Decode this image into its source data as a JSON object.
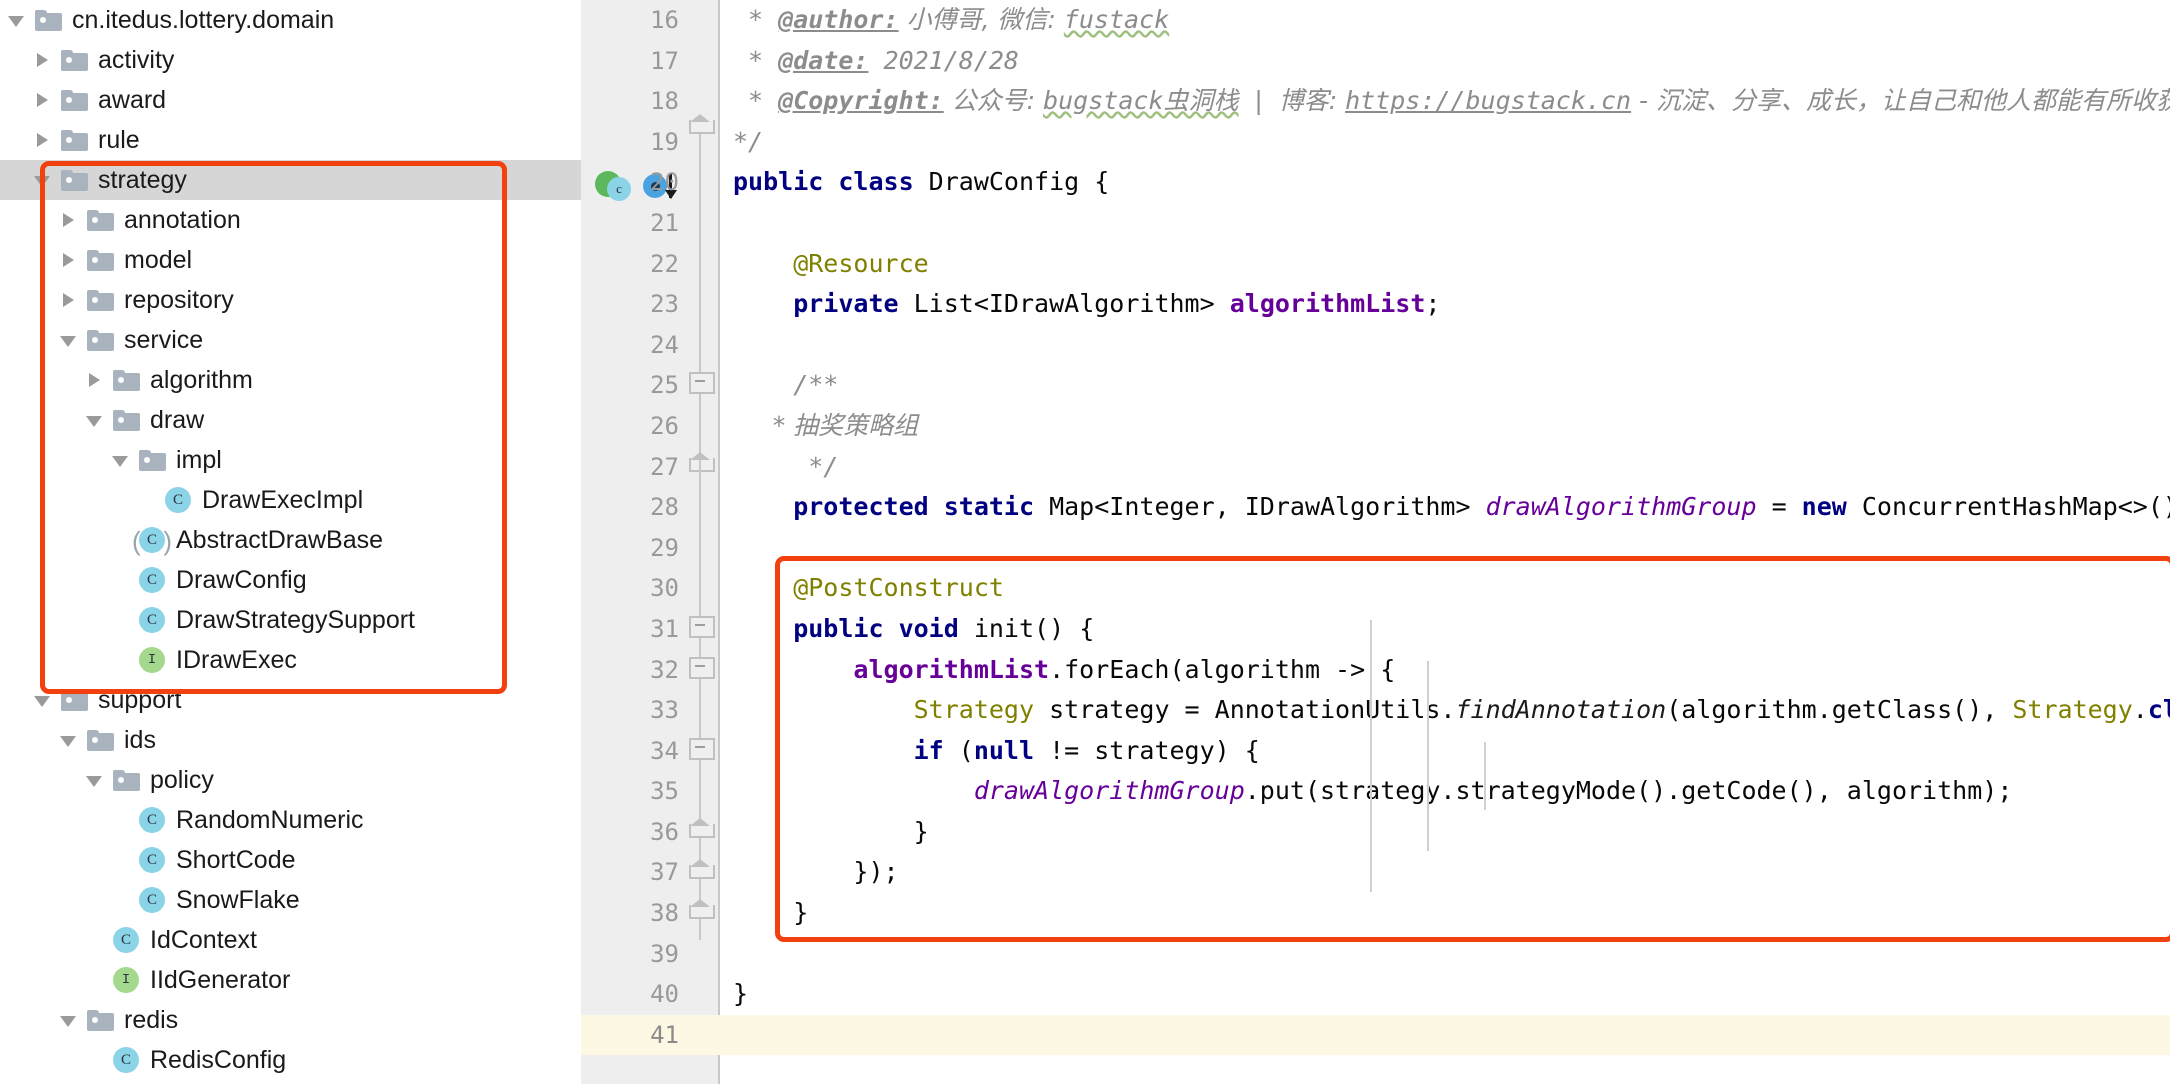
{
  "accent": {
    "highlight_box": "#f2400f",
    "selection_row": "#d6d6d6",
    "caret_line": "#fdf8e3",
    "gutter_bg": "#eeeeee"
  },
  "tree": {
    "root_label": "cn.itedus.lottery.domain",
    "items": [
      {
        "label": "cn.itedus.lottery.domain",
        "kind": "folder",
        "depth": 0,
        "state": "expanded",
        "selected": false
      },
      {
        "label": "activity",
        "kind": "folder",
        "depth": 1,
        "state": "collapsed",
        "selected": false
      },
      {
        "label": "award",
        "kind": "folder",
        "depth": 1,
        "state": "collapsed",
        "selected": false
      },
      {
        "label": "rule",
        "kind": "folder",
        "depth": 1,
        "state": "collapsed",
        "selected": false
      },
      {
        "label": "strategy",
        "kind": "folder",
        "depth": 1,
        "state": "expanded",
        "selected": true
      },
      {
        "label": "annotation",
        "kind": "folder",
        "depth": 2,
        "state": "collapsed",
        "selected": false
      },
      {
        "label": "model",
        "kind": "folder",
        "depth": 2,
        "state": "collapsed",
        "selected": false
      },
      {
        "label": "repository",
        "kind": "folder",
        "depth": 2,
        "state": "collapsed",
        "selected": false
      },
      {
        "label": "service",
        "kind": "folder",
        "depth": 2,
        "state": "expanded",
        "selected": false
      },
      {
        "label": "algorithm",
        "kind": "folder",
        "depth": 3,
        "state": "collapsed",
        "selected": false
      },
      {
        "label": "draw",
        "kind": "folder",
        "depth": 3,
        "state": "expanded",
        "selected": false
      },
      {
        "label": "impl",
        "kind": "folder",
        "depth": 4,
        "state": "expanded",
        "selected": false
      },
      {
        "label": "DrawExecImpl",
        "kind": "class",
        "depth": 5,
        "state": "leaf",
        "selected": false
      },
      {
        "label": "AbstractDrawBase",
        "kind": "abstract-class",
        "depth": 4,
        "state": "leaf",
        "selected": false
      },
      {
        "label": "DrawConfig",
        "kind": "class",
        "depth": 4,
        "state": "leaf",
        "selected": false
      },
      {
        "label": "DrawStrategySupport",
        "kind": "class",
        "depth": 4,
        "state": "leaf",
        "selected": false
      },
      {
        "label": "IDrawExec",
        "kind": "interface",
        "depth": 4,
        "state": "leaf",
        "selected": false
      },
      {
        "label": "support",
        "kind": "folder",
        "depth": 1,
        "state": "expanded",
        "selected": false
      },
      {
        "label": "ids",
        "kind": "folder",
        "depth": 2,
        "state": "expanded",
        "selected": false
      },
      {
        "label": "policy",
        "kind": "folder",
        "depth": 3,
        "state": "expanded",
        "selected": false
      },
      {
        "label": "RandomNumeric",
        "kind": "class",
        "depth": 4,
        "state": "leaf",
        "selected": false
      },
      {
        "label": "ShortCode",
        "kind": "class",
        "depth": 4,
        "state": "leaf",
        "selected": false
      },
      {
        "label": "SnowFlake",
        "kind": "class",
        "depth": 4,
        "state": "leaf",
        "selected": false
      },
      {
        "label": "IdContext",
        "kind": "class",
        "depth": 3,
        "state": "leaf",
        "selected": false
      },
      {
        "label": "IIdGenerator",
        "kind": "interface",
        "depth": 3,
        "state": "leaf",
        "selected": false
      },
      {
        "label": "redis",
        "kind": "folder",
        "depth": 2,
        "state": "expanded",
        "selected": false
      },
      {
        "label": "RedisConfig",
        "kind": "class",
        "depth": 3,
        "state": "leaf",
        "selected": false
      }
    ]
  },
  "editor": {
    "first_line_number": 16,
    "caret_line_number": 41,
    "lines": [
      {
        "n": 16,
        "text": " * @author: 小傅哥, 微信: fustack"
      },
      {
        "n": 17,
        "text": " * @date: 2021/8/28"
      },
      {
        "n": 18,
        "text": " * @Copyright: 公众号: bugstack虫洞栈 | 博客: https://bugstack.cn - 沉淀、分享、成长，让自己和他人都能有所收获！"
      },
      {
        "n": 19,
        "text": " */"
      },
      {
        "n": 20,
        "text": "public class DrawConfig {"
      },
      {
        "n": 21,
        "text": ""
      },
      {
        "n": 22,
        "text": "    @Resource"
      },
      {
        "n": 23,
        "text": "    private List<IDrawAlgorithm> algorithmList;"
      },
      {
        "n": 24,
        "text": ""
      },
      {
        "n": 25,
        "text": "    /**"
      },
      {
        "n": 26,
        "text": "     * 抽奖策略组"
      },
      {
        "n": 27,
        "text": "     */"
      },
      {
        "n": 28,
        "text": "    protected static Map<Integer, IDrawAlgorithm> drawAlgorithmGroup = new ConcurrentHashMap<>();"
      },
      {
        "n": 29,
        "text": ""
      },
      {
        "n": 30,
        "text": "    @PostConstruct"
      },
      {
        "n": 31,
        "text": "    public void init() {"
      },
      {
        "n": 32,
        "text": "        algorithmList.forEach(algorithm -> {"
      },
      {
        "n": 33,
        "text": "            Strategy strategy = AnnotationUtils.findAnnotation(algorithm.getClass(), Strategy.class);"
      },
      {
        "n": 34,
        "text": "            if (null != strategy) {"
      },
      {
        "n": 35,
        "text": "                drawAlgorithmGroup.put(strategy.strategyMode().getCode(), algorithm);"
      },
      {
        "n": 36,
        "text": "            }"
      },
      {
        "n": 37,
        "text": "        });"
      },
      {
        "n": 38,
        "text": "    }"
      },
      {
        "n": 39,
        "text": ""
      },
      {
        "n": 40,
        "text": "}"
      },
      {
        "n": 41,
        "text": ""
      }
    ],
    "comment_tokens": {
      "author_tag": "@author:",
      "author_value": "小傅哥, 微信:",
      "author_handle": "fustack",
      "date_tag": "@date:",
      "date_value": "2021/8/28",
      "copyright_tag": "@Copyright:",
      "copyright_prefix": "公众号:",
      "copyright_account": "bugstack虫洞栈",
      "copyright_sep": "|  博客:",
      "copyright_url": "https://bugstack.cn",
      "copyright_suffix": "- 沉淀、分享、成长，让自己和他人都能有所收获！",
      "javadoc_open": "/**",
      "javadoc_body": "* 抽奖策略组",
      "javadoc_close": "*/",
      "comment_close": "*/"
    },
    "code_tokens": {
      "l20_kw": "public class",
      "l20_name": "DrawConfig {",
      "l22_anno": "@Resource",
      "l23_kw": "private",
      "l23_type": "List<IDrawAlgorithm>",
      "l23_field": "algorithmList",
      "l28_kw": "protected static",
      "l28_type": "Map<Integer, IDrawAlgorithm>",
      "l28_field": "drawAlgorithmGroup",
      "l28_assign": "=",
      "l28_new": "new",
      "l28_ctor": "ConcurrentHashMap<>();",
      "l30_anno": "@PostConstruct",
      "l31_kw": "public void",
      "l31_name": "init() {",
      "l32_field": "algorithmList",
      "l32_rest": ".forEach(algorithm -> {",
      "l33_type": "Strategy",
      "l33_var": "strategy = AnnotationUtils.",
      "l33_mth": "findAnnotation",
      "l33_args": "(algorithm.getClass(), ",
      "l33_type2": "Strategy",
      "l33_dot": ".",
      "l33_class": "class",
      "l33_tail": ");",
      "l34_if": "if",
      "l34_open": " (",
      "l34_null": "null",
      "l34_rest": " != strategy) {",
      "l35_field": "drawAlgorithmGroup",
      "l35_rest": ".put(strategy.strategyMode().getCode(), algorithm);",
      "l36": "}",
      "l37": "});",
      "l38": "}",
      "l40": "}"
    },
    "gutter_marks": {
      "line20_bean_icon": "spring-bean-icon",
      "line20_class_icon": "class-marker-icon",
      "line20_override_icon": "implemented-by-icon"
    }
  }
}
